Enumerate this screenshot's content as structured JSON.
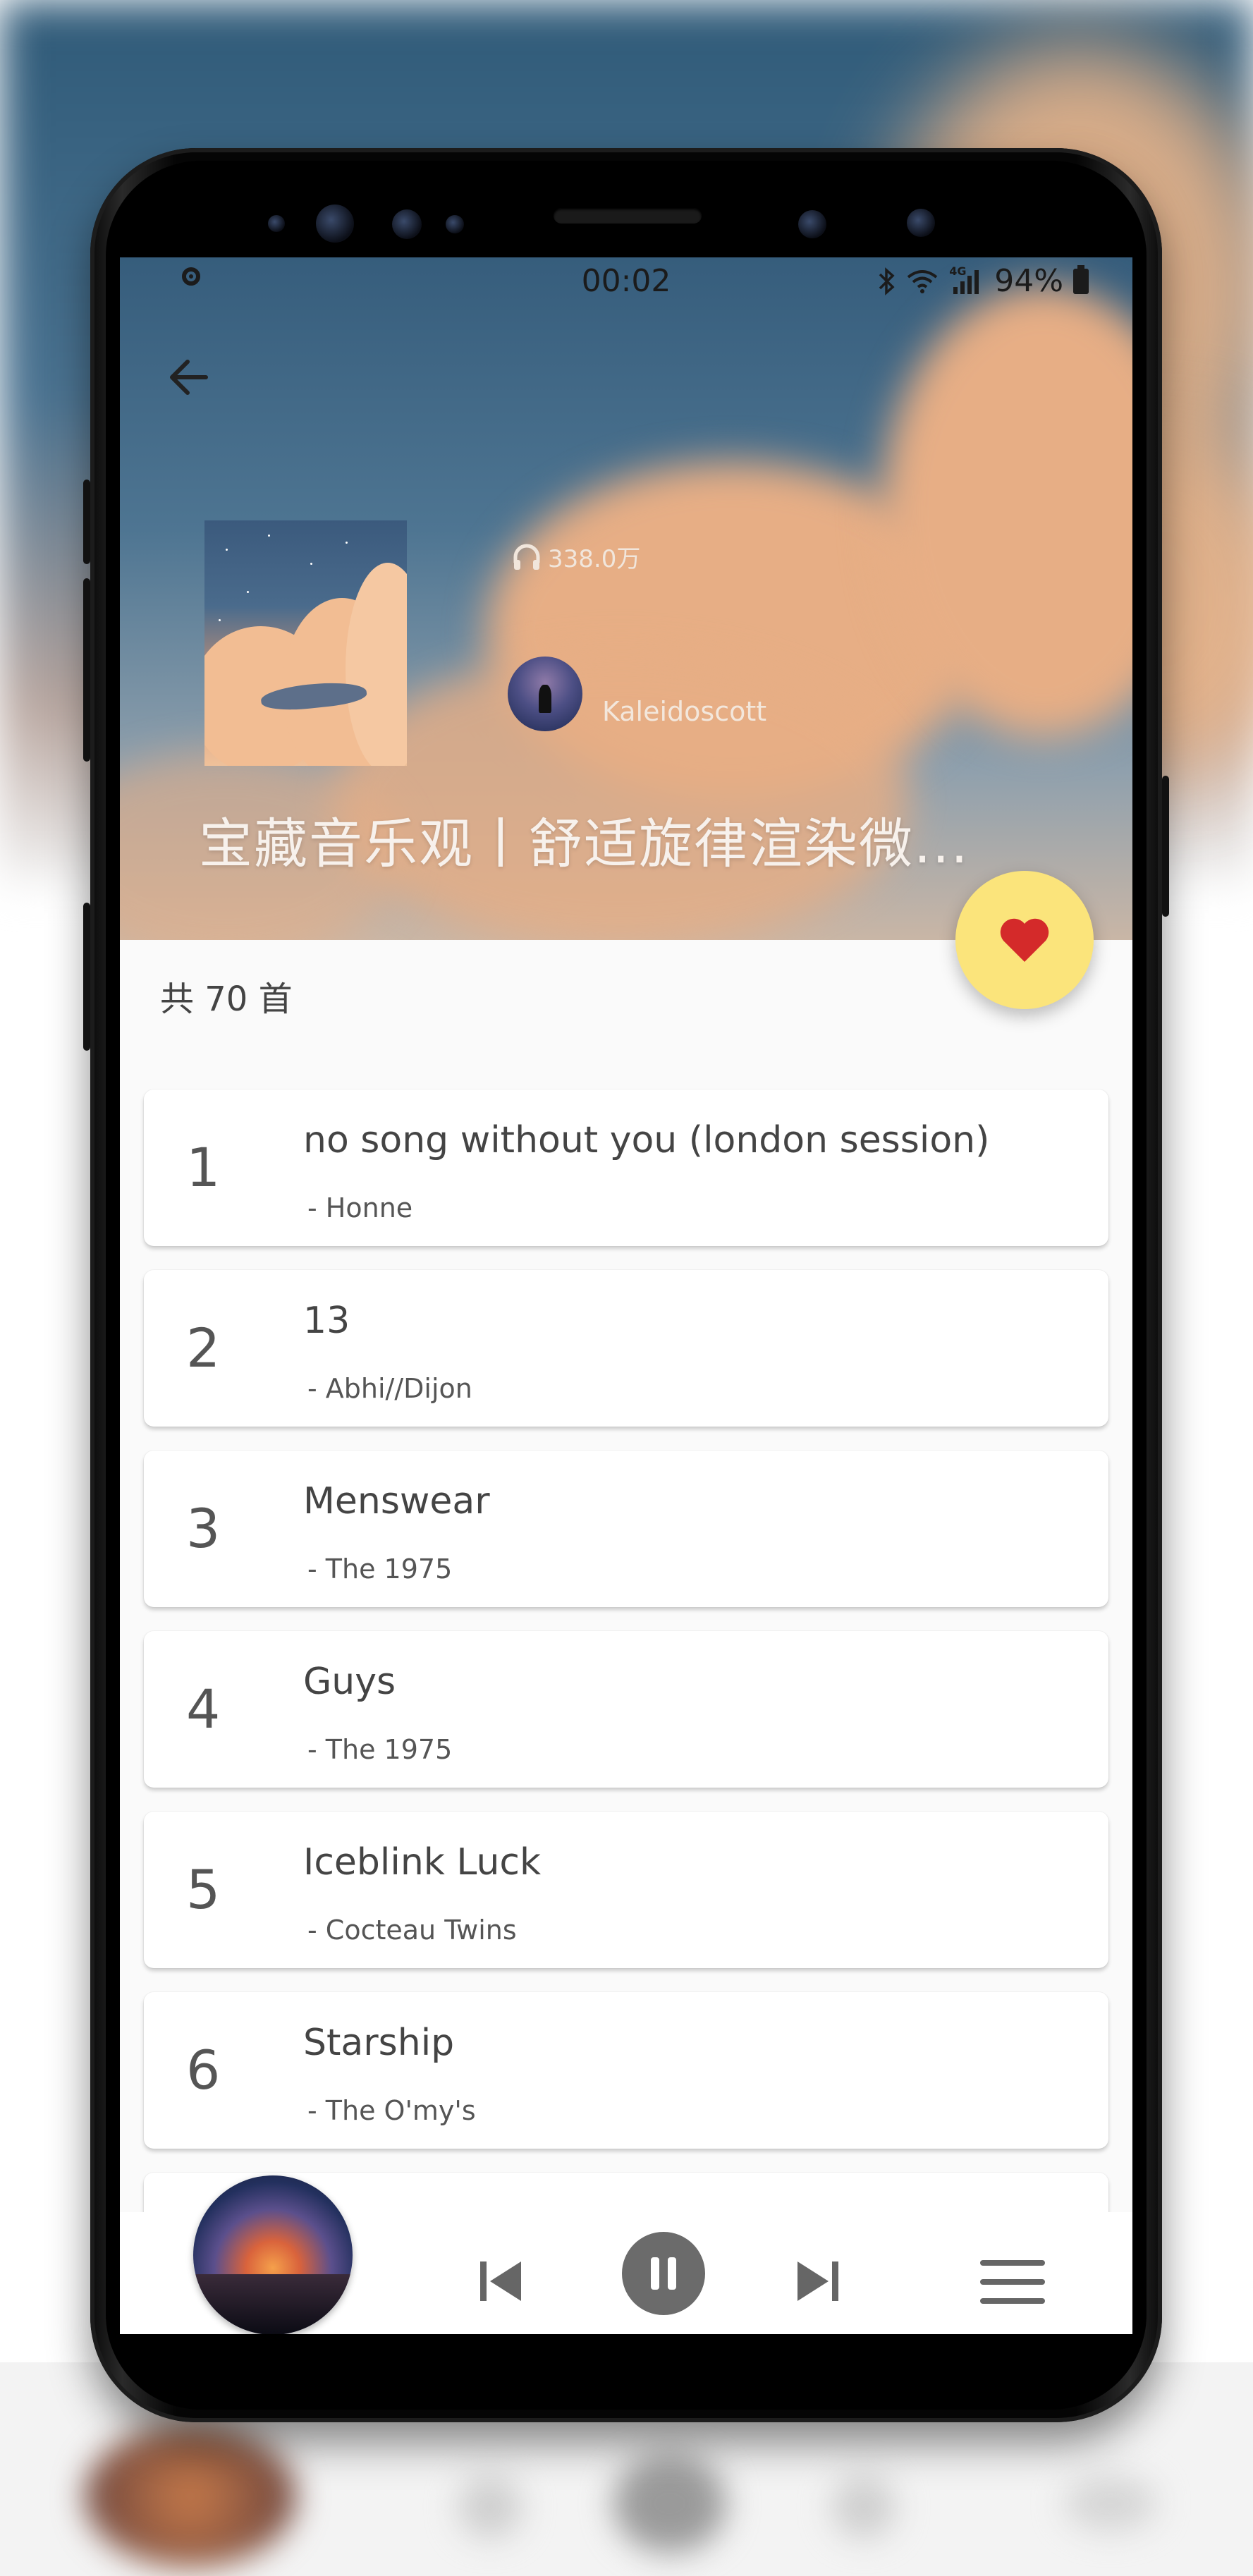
{
  "status_bar": {
    "time": "00:02",
    "battery": "94%",
    "network": "4G"
  },
  "playlist": {
    "plays": "338.0万",
    "creator": "Kaleidoscott",
    "title": "宝藏音乐观丨舒适旋律渲染微...",
    "count_text": "共 70 首"
  },
  "songs": [
    {
      "index": "1",
      "title": "no song without you (london session)",
      "artist": "- Honne"
    },
    {
      "index": "2",
      "title": "13",
      "artist": "- Abhi//Dijon"
    },
    {
      "index": "3",
      "title": "Menswear",
      "artist": "- The 1975"
    },
    {
      "index": "4",
      "title": "Guys",
      "artist": "- The 1975"
    },
    {
      "index": "5",
      "title": "Iceblink Luck",
      "artist": "- Cocteau Twins"
    },
    {
      "index": "6",
      "title": "Starship",
      "artist": "- The O'my's"
    }
  ],
  "colors": {
    "fab_background": "#fbe47b",
    "heart": "#d42a2a",
    "pause_button": "#6b6b6b"
  },
  "icons": {
    "back": "arrow-left-icon",
    "plays": "headphones-icon",
    "favorite": "heart-icon",
    "previous": "skip-previous-icon",
    "pause": "pause-icon",
    "next": "skip-next-icon",
    "menu": "menu-icon"
  }
}
